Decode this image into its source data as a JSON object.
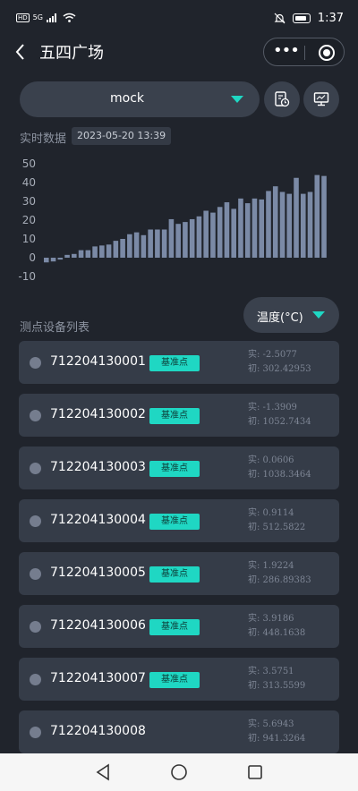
{
  "status_bar": {
    "hd": "HD",
    "network": "5G",
    "time": "1:37"
  },
  "header": {
    "title": "五四广场"
  },
  "dataset_select": {
    "value": "mock"
  },
  "realtime": {
    "label": "实时数据",
    "timestamp": "2023-05-20 13:39"
  },
  "chart_data": {
    "type": "bar",
    "ylim": [
      -10,
      50
    ],
    "yticks": [
      "50",
      "40",
      "30",
      "20",
      "10",
      "0",
      "-10"
    ],
    "values": [
      -2.5,
      -2,
      -1,
      1.5,
      2,
      4,
      4,
      6,
      6.5,
      7,
      9,
      10,
      12.5,
      13.5,
      12,
      15,
      15,
      15,
      20.5,
      18,
      19,
      20.5,
      22,
      25,
      24,
      27,
      29.5,
      26,
      31.5,
      29,
      31.5,
      31,
      35.5,
      38,
      35,
      34,
      42.5,
      34,
      35,
      44,
      43.5
    ],
    "grid": false,
    "bar_color": "#7b8aa6"
  },
  "list": {
    "title": "测点设备列表",
    "metric": "温度(°C)",
    "real_prefix": "实: ",
    "init_prefix": "初: ",
    "devices": [
      {
        "id": "712204130001",
        "badge": "基准点",
        "real": "-2.5077",
        "init": "302.42953"
      },
      {
        "id": "712204130002",
        "badge": "基准点",
        "real": "-1.3909",
        "init": "1052.7434"
      },
      {
        "id": "712204130003",
        "badge": "基准点",
        "real": "0.0606",
        "init": "1038.3464"
      },
      {
        "id": "712204130004",
        "badge": "基准点",
        "real": "0.9114",
        "init": "512.5822"
      },
      {
        "id": "712204130005",
        "badge": "基准点",
        "real": "1.9224",
        "init": "286.89383"
      },
      {
        "id": "712204130006",
        "badge": "基准点",
        "real": "3.9186",
        "init": "448.1638"
      },
      {
        "id": "712204130007",
        "badge": "基准点",
        "real": "3.5751",
        "init": "313.5599"
      },
      {
        "id": "712204130008",
        "badge": "",
        "real": "5.6943",
        "init": "941.3264"
      }
    ]
  },
  "icons": {
    "back": "chevron-left-icon",
    "history": "document-clock-icon",
    "monitor": "monitor-icon"
  },
  "colors": {
    "background": "#20242c",
    "accent": "#1fd7c3",
    "card": "#353c48"
  }
}
